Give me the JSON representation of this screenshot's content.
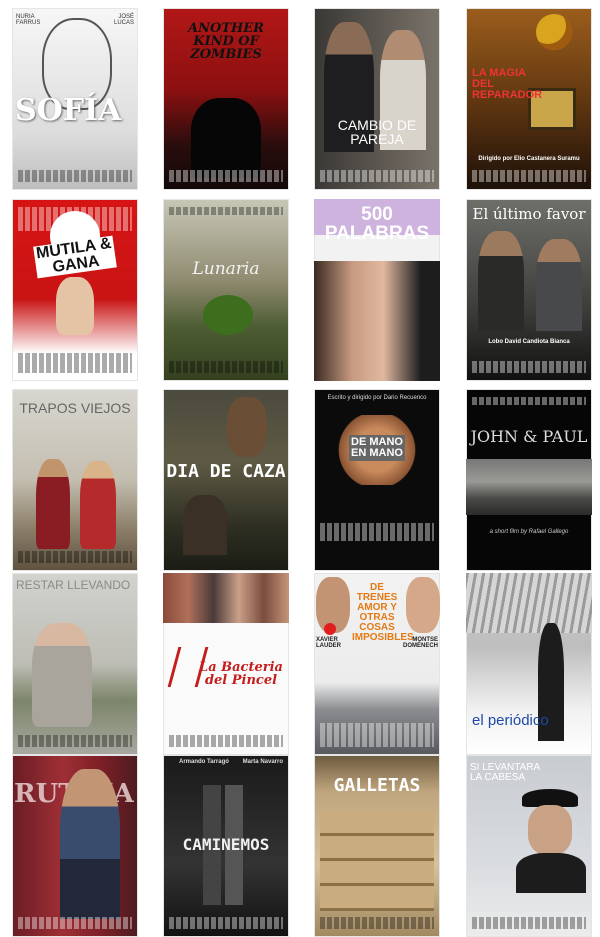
{
  "posters": [
    {
      "id": "sofia",
      "title": "SOFÍA",
      "actor_left": "NURIA FARRUS",
      "actor_right": "JOSÉ LUCAS"
    },
    {
      "id": "zombies",
      "title": "ANOTHER KIND OF ZOMBIES"
    },
    {
      "id": "cambio",
      "title": "CAMBIO DE PAREJA"
    },
    {
      "id": "magia",
      "title": "LA MAGIA DEL REPARADOR",
      "director": "Dirigido por Elio Castanera Suramu"
    },
    {
      "id": "mutila",
      "title": "MUTILA & GANA"
    },
    {
      "id": "lunaria",
      "title": "Lunaria"
    },
    {
      "id": "quinientas",
      "title": "500 PALABRAS"
    },
    {
      "id": "favor",
      "title": "El último favor",
      "cast": "Lobo   David Candiota   Bianca"
    },
    {
      "id": "trapos",
      "title": "TRAPOS VIEJOS"
    },
    {
      "id": "caza",
      "title": "DIA DE CAZA"
    },
    {
      "id": "demano",
      "title": "DE MANO EN MANO",
      "credit": "Escrito y dirigido por Dario Recuenco"
    },
    {
      "id": "john",
      "title": "JOHN & PAUL",
      "byline": "a short film by Rafael Gallego"
    },
    {
      "id": "restar",
      "title": "RESTAR LLEVANDO"
    },
    {
      "id": "bacteria",
      "title": "La Bacteria del Pincel"
    },
    {
      "id": "trenes",
      "title": "DE TRENES AMOR Y OTRAS COSAS IMPOSIBLES",
      "actor_left": "XAVIER LAUDER",
      "actor_right": "MONTSE DOMÉNECH"
    },
    {
      "id": "periodico",
      "title": "el periódico"
    },
    {
      "id": "rutina",
      "title": "RUTINA"
    },
    {
      "id": "caminemos",
      "title": "CAMINEMOS",
      "actor_left": "Armando Tarragó",
      "actor_right": "Marta Navarro"
    },
    {
      "id": "galletas",
      "title": "GALLETAS"
    },
    {
      "id": "levantara",
      "title": "SI LEVANTARA LA CABESA"
    }
  ]
}
